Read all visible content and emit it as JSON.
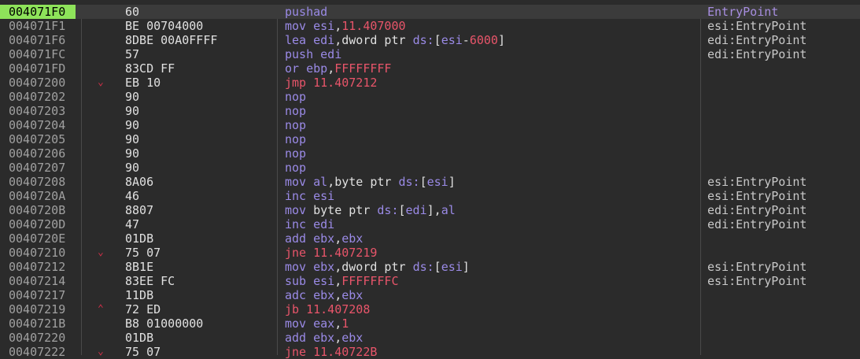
{
  "rows": [
    {
      "addr": "004071F0",
      "arrow": "",
      "bytes": "60",
      "instr": [
        {
          "t": "pushad",
          "c": "mn"
        }
      ],
      "comment": "EntryPoint",
      "commentClass": "ep",
      "current": true,
      "eip": true
    },
    {
      "addr": "004071F1",
      "arrow": "",
      "bytes": "BE 00704000",
      "instr": [
        {
          "t": "mov ",
          "c": "mn"
        },
        {
          "t": "esi",
          "c": "reg"
        },
        {
          "t": ",",
          "c": "txt"
        },
        {
          "t": "11.407000",
          "c": "num"
        }
      ],
      "comment": "esi:EntryPoint"
    },
    {
      "addr": "004071F6",
      "arrow": "",
      "bytes": "8DBE 00A0FFFF",
      "instr": [
        {
          "t": "lea ",
          "c": "mn"
        },
        {
          "t": "edi",
          "c": "reg"
        },
        {
          "t": ",dword ptr ",
          "c": "txt"
        },
        {
          "t": "ds:",
          "c": "seg"
        },
        {
          "t": "[",
          "c": "txt"
        },
        {
          "t": "esi",
          "c": "reg"
        },
        {
          "t": "-",
          "c": "txt"
        },
        {
          "t": "6000",
          "c": "num"
        },
        {
          "t": "]",
          "c": "txt"
        }
      ],
      "comment": "edi:EntryPoint"
    },
    {
      "addr": "004071FC",
      "arrow": "",
      "bytes": "57",
      "instr": [
        {
          "t": "push ",
          "c": "mn"
        },
        {
          "t": "edi",
          "c": "reg"
        }
      ],
      "comment": "edi:EntryPoint"
    },
    {
      "addr": "004071FD",
      "arrow": "",
      "bytes": "83CD FF",
      "instr": [
        {
          "t": "or ",
          "c": "mn"
        },
        {
          "t": "ebp",
          "c": "reg"
        },
        {
          "t": ",",
          "c": "txt"
        },
        {
          "t": "FFFFFFFF",
          "c": "num"
        }
      ],
      "comment": ""
    },
    {
      "addr": "00407200",
      "arrow": "down",
      "bytes": "EB 10",
      "instr": [
        {
          "t": "jmp ",
          "c": "mn jmp"
        },
        {
          "t": "11.407212",
          "c": "num"
        }
      ],
      "comment": ""
    },
    {
      "addr": "00407202",
      "arrow": "",
      "bytes": "90",
      "instr": [
        {
          "t": "nop",
          "c": "mn"
        }
      ],
      "comment": ""
    },
    {
      "addr": "00407203",
      "arrow": "",
      "bytes": "90",
      "instr": [
        {
          "t": "nop",
          "c": "mn"
        }
      ],
      "comment": ""
    },
    {
      "addr": "00407204",
      "arrow": "",
      "bytes": "90",
      "instr": [
        {
          "t": "nop",
          "c": "mn"
        }
      ],
      "comment": ""
    },
    {
      "addr": "00407205",
      "arrow": "",
      "bytes": "90",
      "instr": [
        {
          "t": "nop",
          "c": "mn"
        }
      ],
      "comment": ""
    },
    {
      "addr": "00407206",
      "arrow": "",
      "bytes": "90",
      "instr": [
        {
          "t": "nop",
          "c": "mn"
        }
      ],
      "comment": ""
    },
    {
      "addr": "00407207",
      "arrow": "",
      "bytes": "90",
      "instr": [
        {
          "t": "nop",
          "c": "mn"
        }
      ],
      "comment": ""
    },
    {
      "addr": "00407208",
      "arrow": "",
      "bytes": "8A06",
      "instr": [
        {
          "t": "mov ",
          "c": "mn"
        },
        {
          "t": "al",
          "c": "reg"
        },
        {
          "t": ",byte ptr ",
          "c": "txt"
        },
        {
          "t": "ds:",
          "c": "seg"
        },
        {
          "t": "[",
          "c": "txt"
        },
        {
          "t": "esi",
          "c": "reg"
        },
        {
          "t": "]",
          "c": "txt"
        }
      ],
      "comment": "esi:EntryPoint"
    },
    {
      "addr": "0040720A",
      "arrow": "",
      "bytes": "46",
      "instr": [
        {
          "t": "inc ",
          "c": "mn"
        },
        {
          "t": "esi",
          "c": "reg"
        }
      ],
      "comment": "esi:EntryPoint"
    },
    {
      "addr": "0040720B",
      "arrow": "",
      "bytes": "8807",
      "instr": [
        {
          "t": "mov ",
          "c": "mn"
        },
        {
          "t": "byte ptr ",
          "c": "txt"
        },
        {
          "t": "ds:",
          "c": "seg"
        },
        {
          "t": "[",
          "c": "txt"
        },
        {
          "t": "edi",
          "c": "reg"
        },
        {
          "t": "],",
          "c": "txt"
        },
        {
          "t": "al",
          "c": "reg"
        }
      ],
      "comment": "edi:EntryPoint"
    },
    {
      "addr": "0040720D",
      "arrow": "",
      "bytes": "47",
      "instr": [
        {
          "t": "inc ",
          "c": "mn"
        },
        {
          "t": "edi",
          "c": "reg"
        }
      ],
      "comment": "edi:EntryPoint"
    },
    {
      "addr": "0040720E",
      "arrow": "",
      "bytes": "01DB",
      "instr": [
        {
          "t": "add ",
          "c": "mn"
        },
        {
          "t": "ebx",
          "c": "reg"
        },
        {
          "t": ",",
          "c": "txt"
        },
        {
          "t": "ebx",
          "c": "reg"
        }
      ],
      "comment": ""
    },
    {
      "addr": "00407210",
      "arrow": "down",
      "bytes": "75 07",
      "instr": [
        {
          "t": "jne ",
          "c": "mn jmp"
        },
        {
          "t": "11.407219",
          "c": "num"
        }
      ],
      "comment": ""
    },
    {
      "addr": "00407212",
      "arrow": "",
      "bytes": "8B1E",
      "instr": [
        {
          "t": "mov ",
          "c": "mn"
        },
        {
          "t": "ebx",
          "c": "reg"
        },
        {
          "t": ",dword ptr ",
          "c": "txt"
        },
        {
          "t": "ds:",
          "c": "seg"
        },
        {
          "t": "[",
          "c": "txt"
        },
        {
          "t": "esi",
          "c": "reg"
        },
        {
          "t": "]",
          "c": "txt"
        }
      ],
      "comment": "esi:EntryPoint"
    },
    {
      "addr": "00407214",
      "arrow": "",
      "bytes": "83EE FC",
      "instr": [
        {
          "t": "sub ",
          "c": "mn"
        },
        {
          "t": "esi",
          "c": "reg"
        },
        {
          "t": ",",
          "c": "txt"
        },
        {
          "t": "FFFFFFFC",
          "c": "num"
        }
      ],
      "comment": "esi:EntryPoint"
    },
    {
      "addr": "00407217",
      "arrow": "",
      "bytes": "11DB",
      "instr": [
        {
          "t": "adc ",
          "c": "mn"
        },
        {
          "t": "ebx",
          "c": "reg"
        },
        {
          "t": ",",
          "c": "txt"
        },
        {
          "t": "ebx",
          "c": "reg"
        }
      ],
      "comment": ""
    },
    {
      "addr": "00407219",
      "arrow": "up",
      "bytes": "72 ED",
      "instr": [
        {
          "t": "jb ",
          "c": "mn jmp"
        },
        {
          "t": "11.407208",
          "c": "num"
        }
      ],
      "comment": ""
    },
    {
      "addr": "0040721B",
      "arrow": "",
      "bytes": "B8 01000000",
      "instr": [
        {
          "t": "mov ",
          "c": "mn"
        },
        {
          "t": "eax",
          "c": "reg"
        },
        {
          "t": ",",
          "c": "txt"
        },
        {
          "t": "1",
          "c": "num"
        }
      ],
      "comment": ""
    },
    {
      "addr": "00407220",
      "arrow": "",
      "bytes": "01DB",
      "instr": [
        {
          "t": "add ",
          "c": "mn"
        },
        {
          "t": "ebx",
          "c": "reg"
        },
        {
          "t": ",",
          "c": "txt"
        },
        {
          "t": "ebx",
          "c": "reg"
        }
      ],
      "comment": ""
    },
    {
      "addr": "00407222",
      "arrow": "down",
      "bytes": "75 07",
      "instr": [
        {
          "t": "jne ",
          "c": "mn jmp"
        },
        {
          "t": "11.40722B",
          "c": "num"
        }
      ],
      "comment": ""
    }
  ],
  "arrow_glyphs": {
    "down": "⌵",
    "up": "⌃"
  },
  "colors": {
    "eip_highlight": "#8ee35a",
    "background": "#2b2b2b",
    "mnemonic": "#9a8ae6",
    "jump": "#e8556a"
  }
}
